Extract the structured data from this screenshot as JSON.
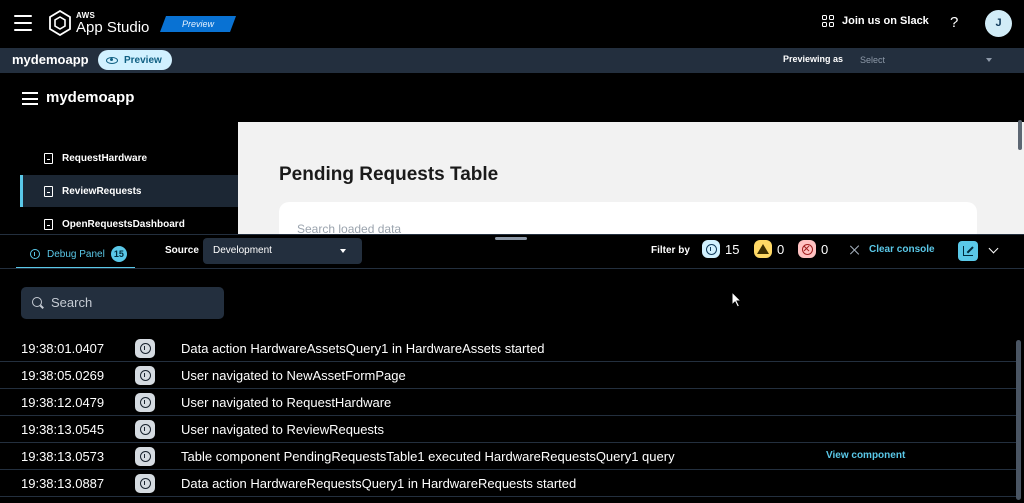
{
  "topbar": {
    "logo_small": "AWS",
    "logo_main": "App Studio",
    "preview_badge": "Preview",
    "slack_label": "Join us on Slack",
    "help_label": "?",
    "avatar_initial": "J"
  },
  "appbar": {
    "app_name": "mydemoapp",
    "preview_pill": "Preview",
    "previewing_as_label": "Previewing as",
    "previewing_as_value": "Select"
  },
  "canvas": {
    "title": "mydemoapp",
    "nav": [
      {
        "label": "RequestHardware",
        "active": false
      },
      {
        "label": "ReviewRequests",
        "active": true
      },
      {
        "label": "OpenRequestsDashboard",
        "active": false
      }
    ],
    "page_title": "Pending Requests Table",
    "search_placeholder": "Search loaded data"
  },
  "debug": {
    "tab_label": "Debug Panel",
    "tab_count": "15",
    "source_label": "Source",
    "source_value": "Development",
    "filter_label": "Filter by",
    "info_count": "15",
    "warning_count": "0",
    "error_count": "0",
    "clear_label": "Clear console",
    "search_placeholder": "Search",
    "logs": [
      {
        "time": "19:38:01.0407",
        "message": "Data action HardwareAssetsQuery1 in HardwareAssets started",
        "link": ""
      },
      {
        "time": "19:38:05.0269",
        "message": "User navigated to NewAssetFormPage",
        "link": ""
      },
      {
        "time": "19:38:12.0479",
        "message": "User navigated to RequestHardware",
        "link": ""
      },
      {
        "time": "19:38:13.0545",
        "message": "User navigated to ReviewRequests",
        "link": ""
      },
      {
        "time": "19:38:13.0573",
        "message": "Table component PendingRequestsTable1 executed HardwareRequestsQuery1 query",
        "link": "View component"
      },
      {
        "time": "19:38:13.0887",
        "message": "Data action HardwareRequestsQuery1 in HardwareRequests started",
        "link": ""
      }
    ]
  },
  "colors": {
    "accent": "#5ac8e8",
    "appbar": "#232f3e",
    "preview_badge": "#0972d3",
    "warning": "#ffd966",
    "error": "#ffc2c2"
  }
}
